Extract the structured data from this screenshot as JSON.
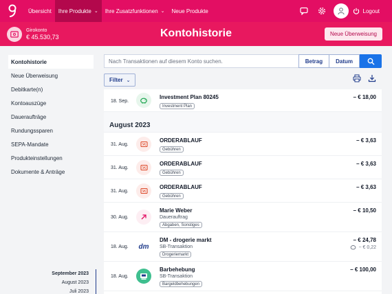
{
  "nav": {
    "items": [
      {
        "label": "Übersicht",
        "active": false
      },
      {
        "label": "Ihre Produkte",
        "active": true,
        "dropdown": true
      },
      {
        "label": "Ihre Zusatzfunktionen",
        "active": false,
        "dropdown": true
      },
      {
        "label": "Neue Produkte",
        "active": false
      }
    ],
    "logout_label": "Logout",
    "icons": [
      "logo-icon",
      "chat-icon",
      "gear-icon",
      "user-icon",
      "power-icon"
    ]
  },
  "account": {
    "name": "Girokonto",
    "balance": "€ 45.530,73"
  },
  "page_title": "Kontohistorie",
  "new_transfer_label": "Neue Überweisung",
  "sidebar": {
    "items": [
      {
        "label": "Kontohistorie",
        "active": true
      },
      {
        "label": "Neue Überweisung"
      },
      {
        "label": "Debitkarte(n)"
      },
      {
        "label": "Kontoauszüge"
      },
      {
        "label": "Daueraufträge"
      },
      {
        "label": "Rundungssparen"
      },
      {
        "label": "SEPA-Mandate"
      },
      {
        "label": "Produkteinstellungen"
      },
      {
        "label": "Dokumente & Anträge"
      }
    ]
  },
  "timeline": [
    {
      "label": "September 2023",
      "active": true
    },
    {
      "label": "August 2023"
    },
    {
      "label": "Juli 2023"
    }
  ],
  "search": {
    "placeholder": "Nach Transaktionen auf diesem Konto suchen.",
    "value": "",
    "sort_amount_label": "Betrag",
    "sort_date_label": "Datum"
  },
  "filter_label": "Filter",
  "colors": {
    "brand": "#e30e63",
    "accent": "#1a73e8",
    "navy": "#1e3a8a"
  },
  "transactions_top": [
    {
      "date": "18. Sep.",
      "title": "Investment Plan 80245",
      "tag": "Investment Plan",
      "amount": "− € 18,00",
      "icon": "piggy-bank-icon"
    }
  ],
  "month_august": "August 2023",
  "transactions_aug": [
    {
      "date": "31. Aug.",
      "title": "ORDERABLAUF",
      "tag": "Gebühren",
      "amount": "− € 3,63",
      "icon": "fee-icon"
    },
    {
      "date": "31. Aug.",
      "title": "ORDERABLAUF",
      "tag": "Gebühren",
      "amount": "− € 3,63",
      "icon": "fee-icon"
    },
    {
      "date": "31. Aug.",
      "title": "ORDERABLAUF",
      "tag": "Gebühren",
      "amount": "− € 3,63",
      "icon": "fee-icon"
    },
    {
      "date": "30. Aug.",
      "title": "Marie Weber",
      "sub": "Dauerauftrag",
      "tag": "Abgaben, Sonstiges",
      "amount": "− € 10,50",
      "icon": "arrow-up-right-icon"
    },
    {
      "date": "18. Aug.",
      "title": "DM - drogerie markt",
      "sub": "SB-Transaktion",
      "tag": "Drogeriemarkt",
      "amount": "− € 24,78",
      "amount2": "− € 0,22",
      "icon": "dm-logo-icon"
    },
    {
      "date": "18. Aug.",
      "title": "Barbehebung",
      "sub": "SB-Transaktion",
      "tag": "Bargeldbehebungen",
      "amount": "− € 100,00",
      "icon": "atm-icon"
    }
  ]
}
